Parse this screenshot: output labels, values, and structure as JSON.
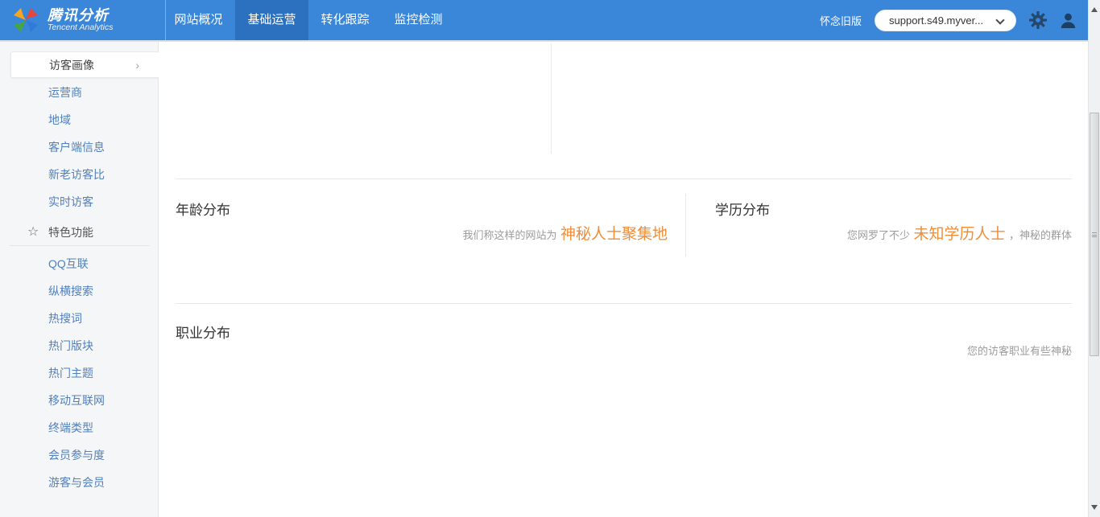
{
  "navbar": {
    "brand": {
      "title": "腾讯分析",
      "subtitle": "Tencent Analytics"
    },
    "tabs": [
      {
        "label": "网站概况",
        "active": false
      },
      {
        "label": "基础运营",
        "active": true
      },
      {
        "label": "转化跟踪",
        "active": false
      },
      {
        "label": "监控检测",
        "active": false
      }
    ],
    "old_version_link": "怀念旧版",
    "site_selector": {
      "value": "support.s49.myver..."
    },
    "icons": {
      "settings": "gear",
      "account": "user-silhouette",
      "dropdown": "chevron-down"
    }
  },
  "sidebar": {
    "selected_item": {
      "label": "访客画像",
      "chevron": "›"
    },
    "items_top": [
      "运营商",
      "地域",
      "客户端信息",
      "新老访客比",
      "实时访客"
    ],
    "section_header": {
      "label": "特色功能",
      "icon": "☆"
    },
    "items_features": [
      "QQ互联",
      "纵横搜索",
      "热搜词",
      "热门版块",
      "热门主题",
      "移动互联网",
      "终端类型",
      "会员参与度",
      "游客与会员"
    ]
  },
  "main": {
    "age_section": {
      "title": "年龄分布",
      "caption_prefix": "我们称这样的网站为",
      "caption_highlight": "神秘人士聚集地"
    },
    "education_section": {
      "title": "学历分布",
      "caption_prefix": "您网罗了不少",
      "caption_highlight": "未知学历人士",
      "caption_suffix": "，神秘的群体"
    },
    "occupation_section": {
      "title": "职业分布",
      "caption": "您的访客职业有些神秘"
    }
  },
  "colors": {
    "navbar_blue": "#3a86d8",
    "active_tab_blue": "#2c70c0",
    "accent_orange": "#ef8d3a",
    "sidebar_link_blue": "#5180be",
    "caption_gray": "#9b9b9b"
  }
}
